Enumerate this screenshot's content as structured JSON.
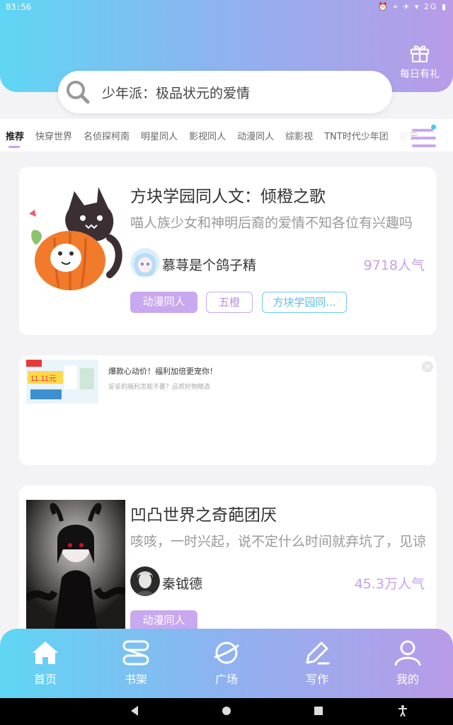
{
  "status_bar": {
    "time": "03:56",
    "icons": "⏰ ⌖ ✈ ▾ 2G ▮"
  },
  "header": {
    "gift_label": "每日有礼"
  },
  "search": {
    "placeholder": "少年派：极品状元的爱情"
  },
  "tabs": [
    {
      "label": "推荐",
      "active": true
    },
    {
      "label": "快穿世界"
    },
    {
      "label": "名侦探柯南"
    },
    {
      "label": "明星同人"
    },
    {
      "label": "影视同人"
    },
    {
      "label": "动漫同人"
    },
    {
      "label": "综影视"
    },
    {
      "label": "TNT时代少年团"
    },
    {
      "label": "德云"
    }
  ],
  "cards": [
    {
      "title": "方块学园同人文：倾橙之歌",
      "description": "喵人族少女和神明后裔的爱情不知各位有兴趣吗",
      "author": "慕荨是个鸽子精",
      "popularity": "9718人气",
      "tags": [
        "动漫同人",
        "五橙",
        "方块学园同..."
      ]
    },
    {
      "title": "凹凸世界之奇葩团厌",
      "description": "咳咳，一时兴起，说不定什么时间就弃坑了，见谅",
      "author": "秦钺德",
      "popularity": "45.3万人气",
      "tags": [
        "动漫同人"
      ]
    }
  ],
  "ad": {
    "title": "爆款心动价！福利加倍更宠你！",
    "subtitle": "妥妥的福利怎能不要？品质好物精选",
    "image_text": "11.11元",
    "close": "×"
  },
  "bottom_nav": [
    {
      "label": "首页",
      "icon": "home-icon"
    },
    {
      "label": "书架",
      "icon": "bookshelf-icon"
    },
    {
      "label": "广场",
      "icon": "planet-icon"
    },
    {
      "label": "写作",
      "icon": "pen-icon"
    },
    {
      "label": "我的",
      "icon": "user-icon"
    }
  ],
  "colors": {
    "gradient_start": "#5fd6f4",
    "gradient_end": "#b99be8",
    "accent": "#c8a8ee",
    "cyan": "#6cc9ea"
  }
}
